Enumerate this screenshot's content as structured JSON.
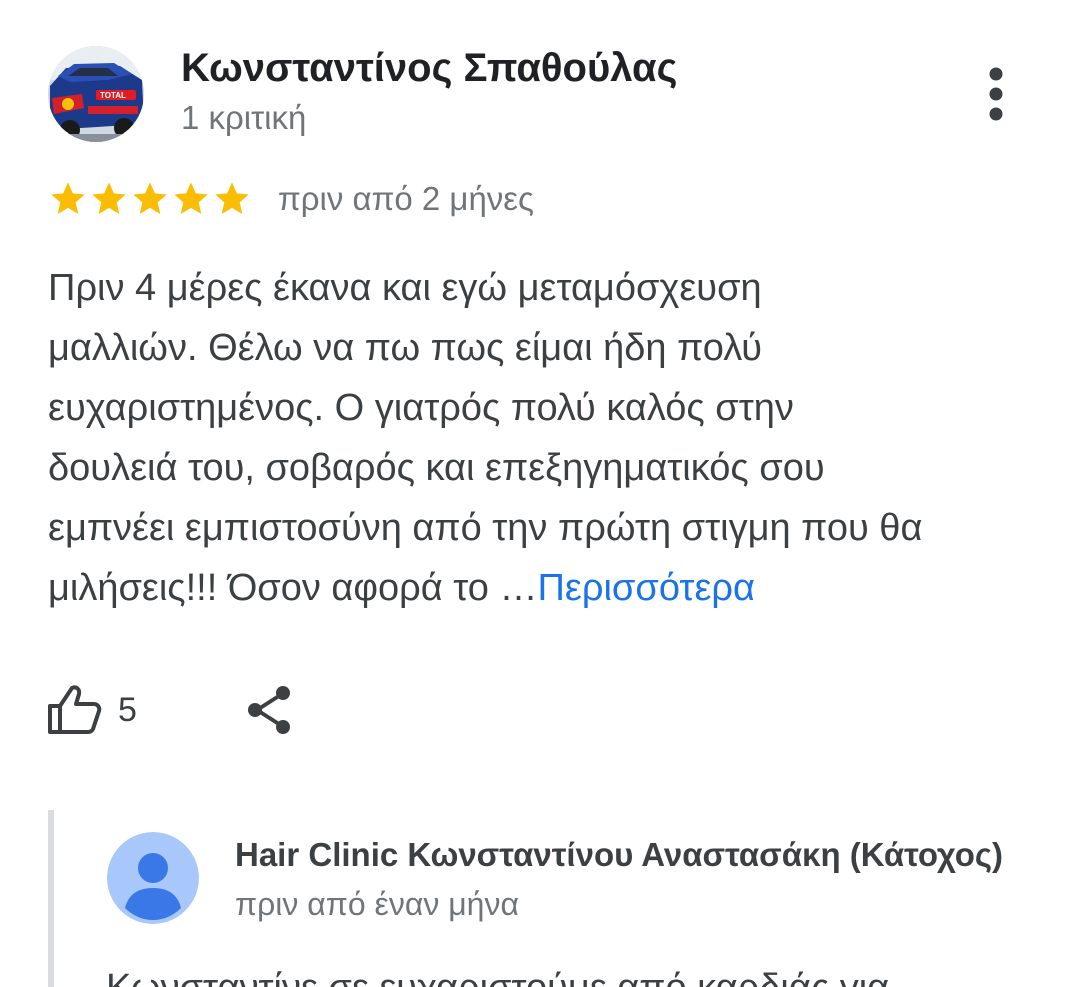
{
  "review": {
    "reviewer_name": "Κωνσταντίνος Σπαθούλας",
    "reviewer_meta": "1 κριτική",
    "rating": 5,
    "rating_max": 5,
    "date": "πριν από 2 μήνες",
    "text_lines": [
      "Πριν 4 μέρες έκανα και εγώ μεταμόσχευση",
      "μαλλιών. Θέλω να πω πως είμαι ήδη πολύ",
      "ευχαριστημένος. Ο γιατρός πολύ καλός στην",
      "δουλειά του, σοβαρός και επεξηγηματικός σου",
      "εμπνέει εμπιστοσύνη από την πρώτη στιγμη που θα",
      "μιλήσεις!!! Όσον αφορά το …"
    ],
    "more_label": "Περισσότερα",
    "like_count": "5",
    "icons": {
      "avatar": "rally-car-avatar",
      "more": "more-vert-icon",
      "star": "star-icon",
      "like": "thumb-up-icon",
      "share": "share-icon"
    },
    "colors": {
      "star": "#fbbc04",
      "link": "#1a73e8",
      "text": "#3c4043",
      "secondary": "#70757a"
    }
  },
  "owner_reply": {
    "name": "Hair Clinic Κωνσταντίνου Αναστασάκη (Κάτοχος)",
    "date": "πριν από έναν μήνα",
    "text": "Κωνσταντίνε σε ευχαριστούμε από καρδιάς για",
    "icons": {
      "avatar": "default-person-avatar"
    },
    "colors": {
      "avatar_bg": "#a8c7fa",
      "avatar_fg": "#3b78e7",
      "border": "#dadce0"
    }
  }
}
